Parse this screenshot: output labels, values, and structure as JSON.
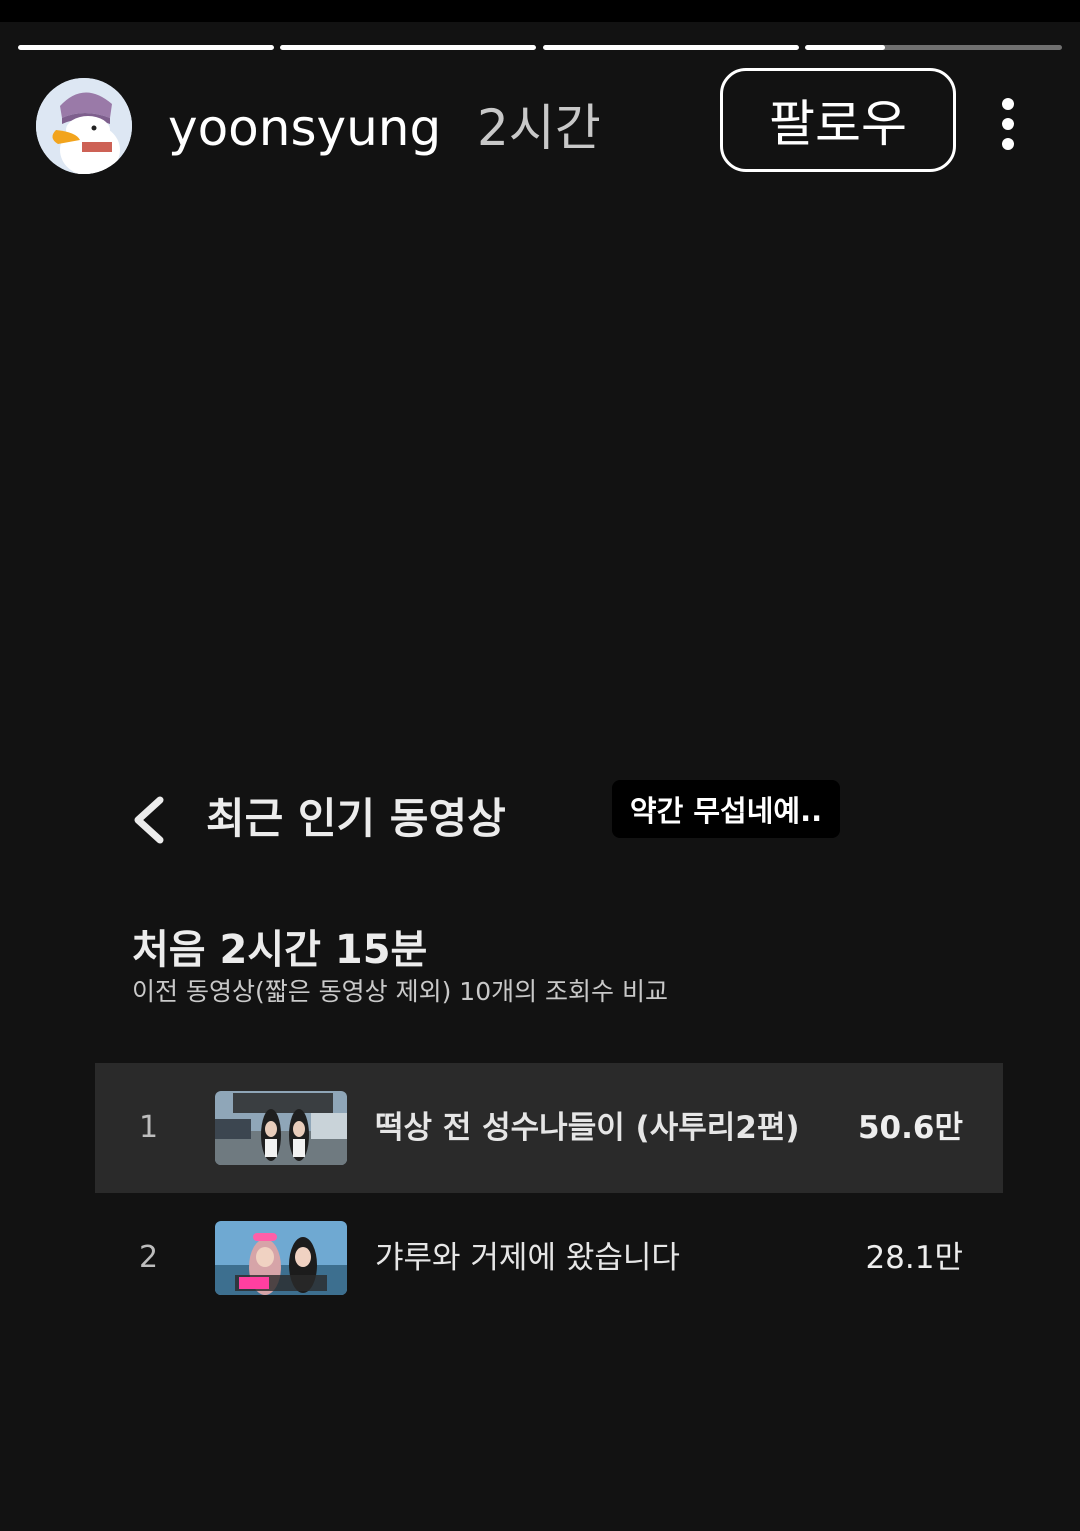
{
  "story": {
    "username": "yoonsyung",
    "time_ago": "2시간",
    "follow_label": "팔로우",
    "segments_total": 4,
    "active_segment": 4,
    "active_segment_progress": 0.31
  },
  "card": {
    "title": "최근 인기 동영상",
    "period": "처음 2시간 15분",
    "description": "이전 동영상(짧은 동영상 제외) 10개의 조회수 비교",
    "videos": [
      {
        "rank": "1",
        "title": "떡상 전 성수나들이 (사투리2편)",
        "views": "50.6만",
        "highlighted": true
      },
      {
        "rank": "2",
        "title": "갸루와 거제에 왔습니다",
        "views": "28.1만",
        "highlighted": false
      }
    ]
  },
  "overlay_caption": "약간 무섭네예..",
  "colors": {
    "background": "#121212",
    "highlight_row": "#2a2a2a",
    "caption_bg": "#000000"
  }
}
